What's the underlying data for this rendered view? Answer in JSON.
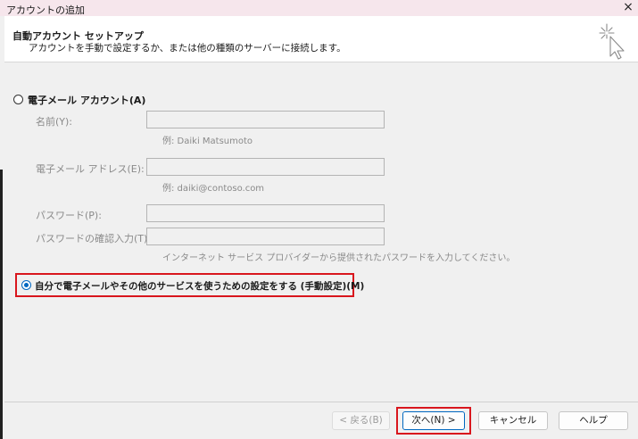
{
  "window": {
    "title": "アカウントの追加",
    "close_glyph": "×"
  },
  "header": {
    "title": "自動アカウント セットアップ",
    "subtitle": "アカウントを手動で設定するか、または他の種類のサーバーに接続します。",
    "icon": "cursor-sparkle-icon"
  },
  "email_account": {
    "option_label": "電子メール アカウント(A)",
    "selected": false,
    "name_label": "名前(Y):",
    "name_value": "",
    "name_hint": "例: Daiki Matsumoto",
    "email_label": "電子メール アドレス(E):",
    "email_value": "",
    "email_hint": "例: daiki@contoso.com",
    "password_label": "パスワード(P):",
    "password_value": "",
    "password_confirm_label": "パスワードの確認入力(T):",
    "password_confirm_value": "",
    "password_hint": "インターネット サービス プロバイダーから提供されたパスワードを入力してください。"
  },
  "manual_setup": {
    "option_label": "自分で電子メールやその他のサービスを使うための設定をする (手動設定)(M)",
    "selected": true
  },
  "footer": {
    "back_label": "< 戻る(B)",
    "next_label": "次へ(N) >",
    "cancel_label": "キャンセル",
    "help_label": "ヘルプ"
  },
  "colors": {
    "accent": "#0067c0",
    "highlight": "#d9161d",
    "titlebar": "#f6e6ec"
  }
}
